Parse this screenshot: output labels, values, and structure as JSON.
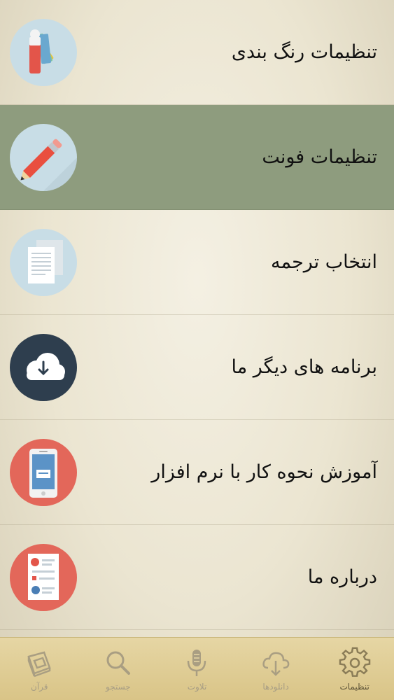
{
  "menu": {
    "items": [
      {
        "label": "تنظیمات رنگ بندی",
        "icon": "color-palette-icon",
        "selected": false
      },
      {
        "label": "تنظیمات فونت",
        "icon": "pencil-icon",
        "selected": true
      },
      {
        "label": "انتخاب ترجمه",
        "icon": "documents-icon",
        "selected": false
      },
      {
        "label": "برنامه های دیگر ما",
        "icon": "cloud-download-icon",
        "selected": false
      },
      {
        "label": "آموزش نحوه کار با نرم افزار",
        "icon": "phone-tutorial-icon",
        "selected": false
      },
      {
        "label": "درباره ما",
        "icon": "report-document-icon",
        "selected": false
      }
    ]
  },
  "tabbar": {
    "tabs": [
      {
        "label": "قرآن",
        "icon": "book-icon",
        "active": false
      },
      {
        "label": "جستجو",
        "icon": "search-icon",
        "active": false
      },
      {
        "label": "تلاوت",
        "icon": "microphone-icon",
        "active": false
      },
      {
        "label": "دانلودها",
        "icon": "cloud-download-icon",
        "active": false
      },
      {
        "label": "تنظیمات",
        "icon": "gear-icon",
        "active": true
      }
    ]
  },
  "colors": {
    "selected_row": "#8e9c7e",
    "tabbar": "#dccb93",
    "icon_light_blue": "#c8dde6",
    "icon_dark_navy": "#2e3e4e",
    "icon_red": "#e3675a"
  }
}
